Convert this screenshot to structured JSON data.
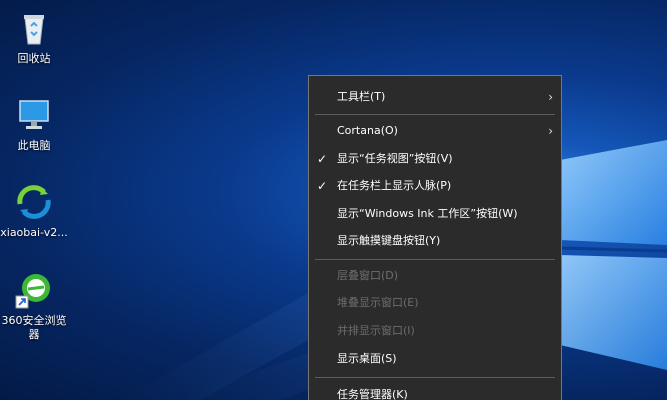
{
  "desktop": {
    "icons": [
      {
        "label": "回收站",
        "icon": "recycle-bin-icon"
      },
      {
        "label": "此电脑",
        "icon": "computer-icon"
      },
      {
        "label": "xiaobai-v2...",
        "icon": "xiaobai-app-icon"
      },
      {
        "label": "360安全浏览器",
        "icon": "browser-360-icon"
      }
    ]
  },
  "context_menu": {
    "items": [
      {
        "label": "工具栏(T)",
        "submenu": true,
        "checked": false,
        "enabled": true
      },
      {
        "label": "Cortana(O)",
        "submenu": true,
        "checked": false,
        "enabled": true
      },
      {
        "label": "显示“任务视图”按钮(V)",
        "submenu": false,
        "checked": true,
        "enabled": true
      },
      {
        "label": "在任务栏上显示人脉(P)",
        "submenu": false,
        "checked": true,
        "enabled": true
      },
      {
        "label": "显示“Windows Ink 工作区”按钮(W)",
        "submenu": false,
        "checked": false,
        "enabled": true
      },
      {
        "label": "显示触摸键盘按钮(Y)",
        "submenu": false,
        "checked": false,
        "enabled": true
      },
      {
        "label": "层叠窗口(D)",
        "submenu": false,
        "checked": false,
        "enabled": false
      },
      {
        "label": "堆叠显示窗口(E)",
        "submenu": false,
        "checked": false,
        "enabled": false
      },
      {
        "label": "并排显示窗口(I)",
        "submenu": false,
        "checked": false,
        "enabled": false
      },
      {
        "label": "显示桌面(S)",
        "submenu": false,
        "checked": false,
        "enabled": true
      },
      {
        "label": "任务管理器(K)",
        "submenu": false,
        "checked": false,
        "enabled": true
      }
    ],
    "check_glyph": "✓",
    "arrow_glyph": "›"
  },
  "colors": {
    "menu_bg": "#2b2b2b",
    "menu_text": "#ffffff",
    "disabled_text": "#6d6d6d",
    "wallpaper_blue": "#1456b7"
  }
}
